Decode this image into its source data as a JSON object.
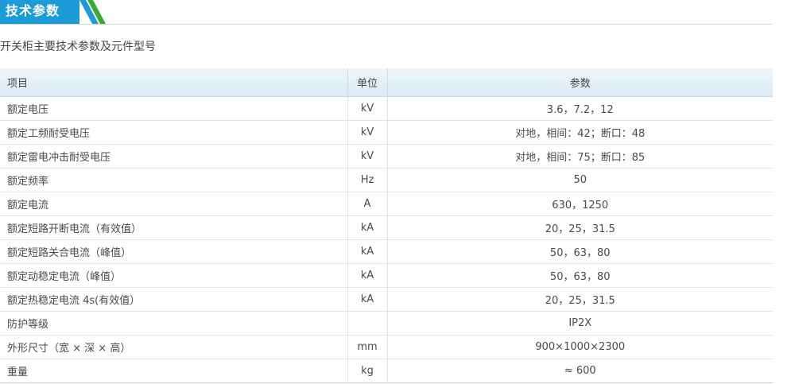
{
  "section": {
    "title": "技术参数"
  },
  "subtitle": "开关柜主要技术参数及元件型号",
  "colors": {
    "header_tab": "#1d9bd8",
    "stripe_green": "#3aaa35",
    "table_header_bg": "#dbeaf5"
  },
  "table": {
    "headers": [
      "项目",
      "单位",
      "参数"
    ],
    "rows": [
      {
        "item": "额定电压",
        "unit": "kV",
        "value": "3.6，7.2，12"
      },
      {
        "item": "额定工频耐受电压",
        "unit": "kV",
        "value": "对地，相间：42；断口：48"
      },
      {
        "item": "额定雷电冲击耐受电压",
        "unit": "kV",
        "value": "对地，相间：75；断口：85"
      },
      {
        "item": "额定频率",
        "unit": "Hz",
        "value": "50"
      },
      {
        "item": "额定电流",
        "unit": "A",
        "value": "630，1250"
      },
      {
        "item": "额定短路开断电流（有效值）",
        "unit": "kA",
        "value": "20，25，31.5"
      },
      {
        "item": "额定短路关合电流（峰值）",
        "unit": "kA",
        "value": "50，63，80"
      },
      {
        "item": "额定动稳定电流（峰值）",
        "unit": "kA",
        "value": "50，63，80"
      },
      {
        "item": "额定热稳定电流 4s(有效值）",
        "unit": "kA",
        "value": "20，25，31.5"
      },
      {
        "item": "防护等级",
        "unit": "",
        "value": "IP2X"
      },
      {
        "item": "外形尺寸（宽 × 深 × 高）",
        "unit": "mm",
        "value": "900×1000×2300"
      },
      {
        "item": "重量",
        "unit": "kg",
        "value": "≈ 600"
      }
    ]
  }
}
